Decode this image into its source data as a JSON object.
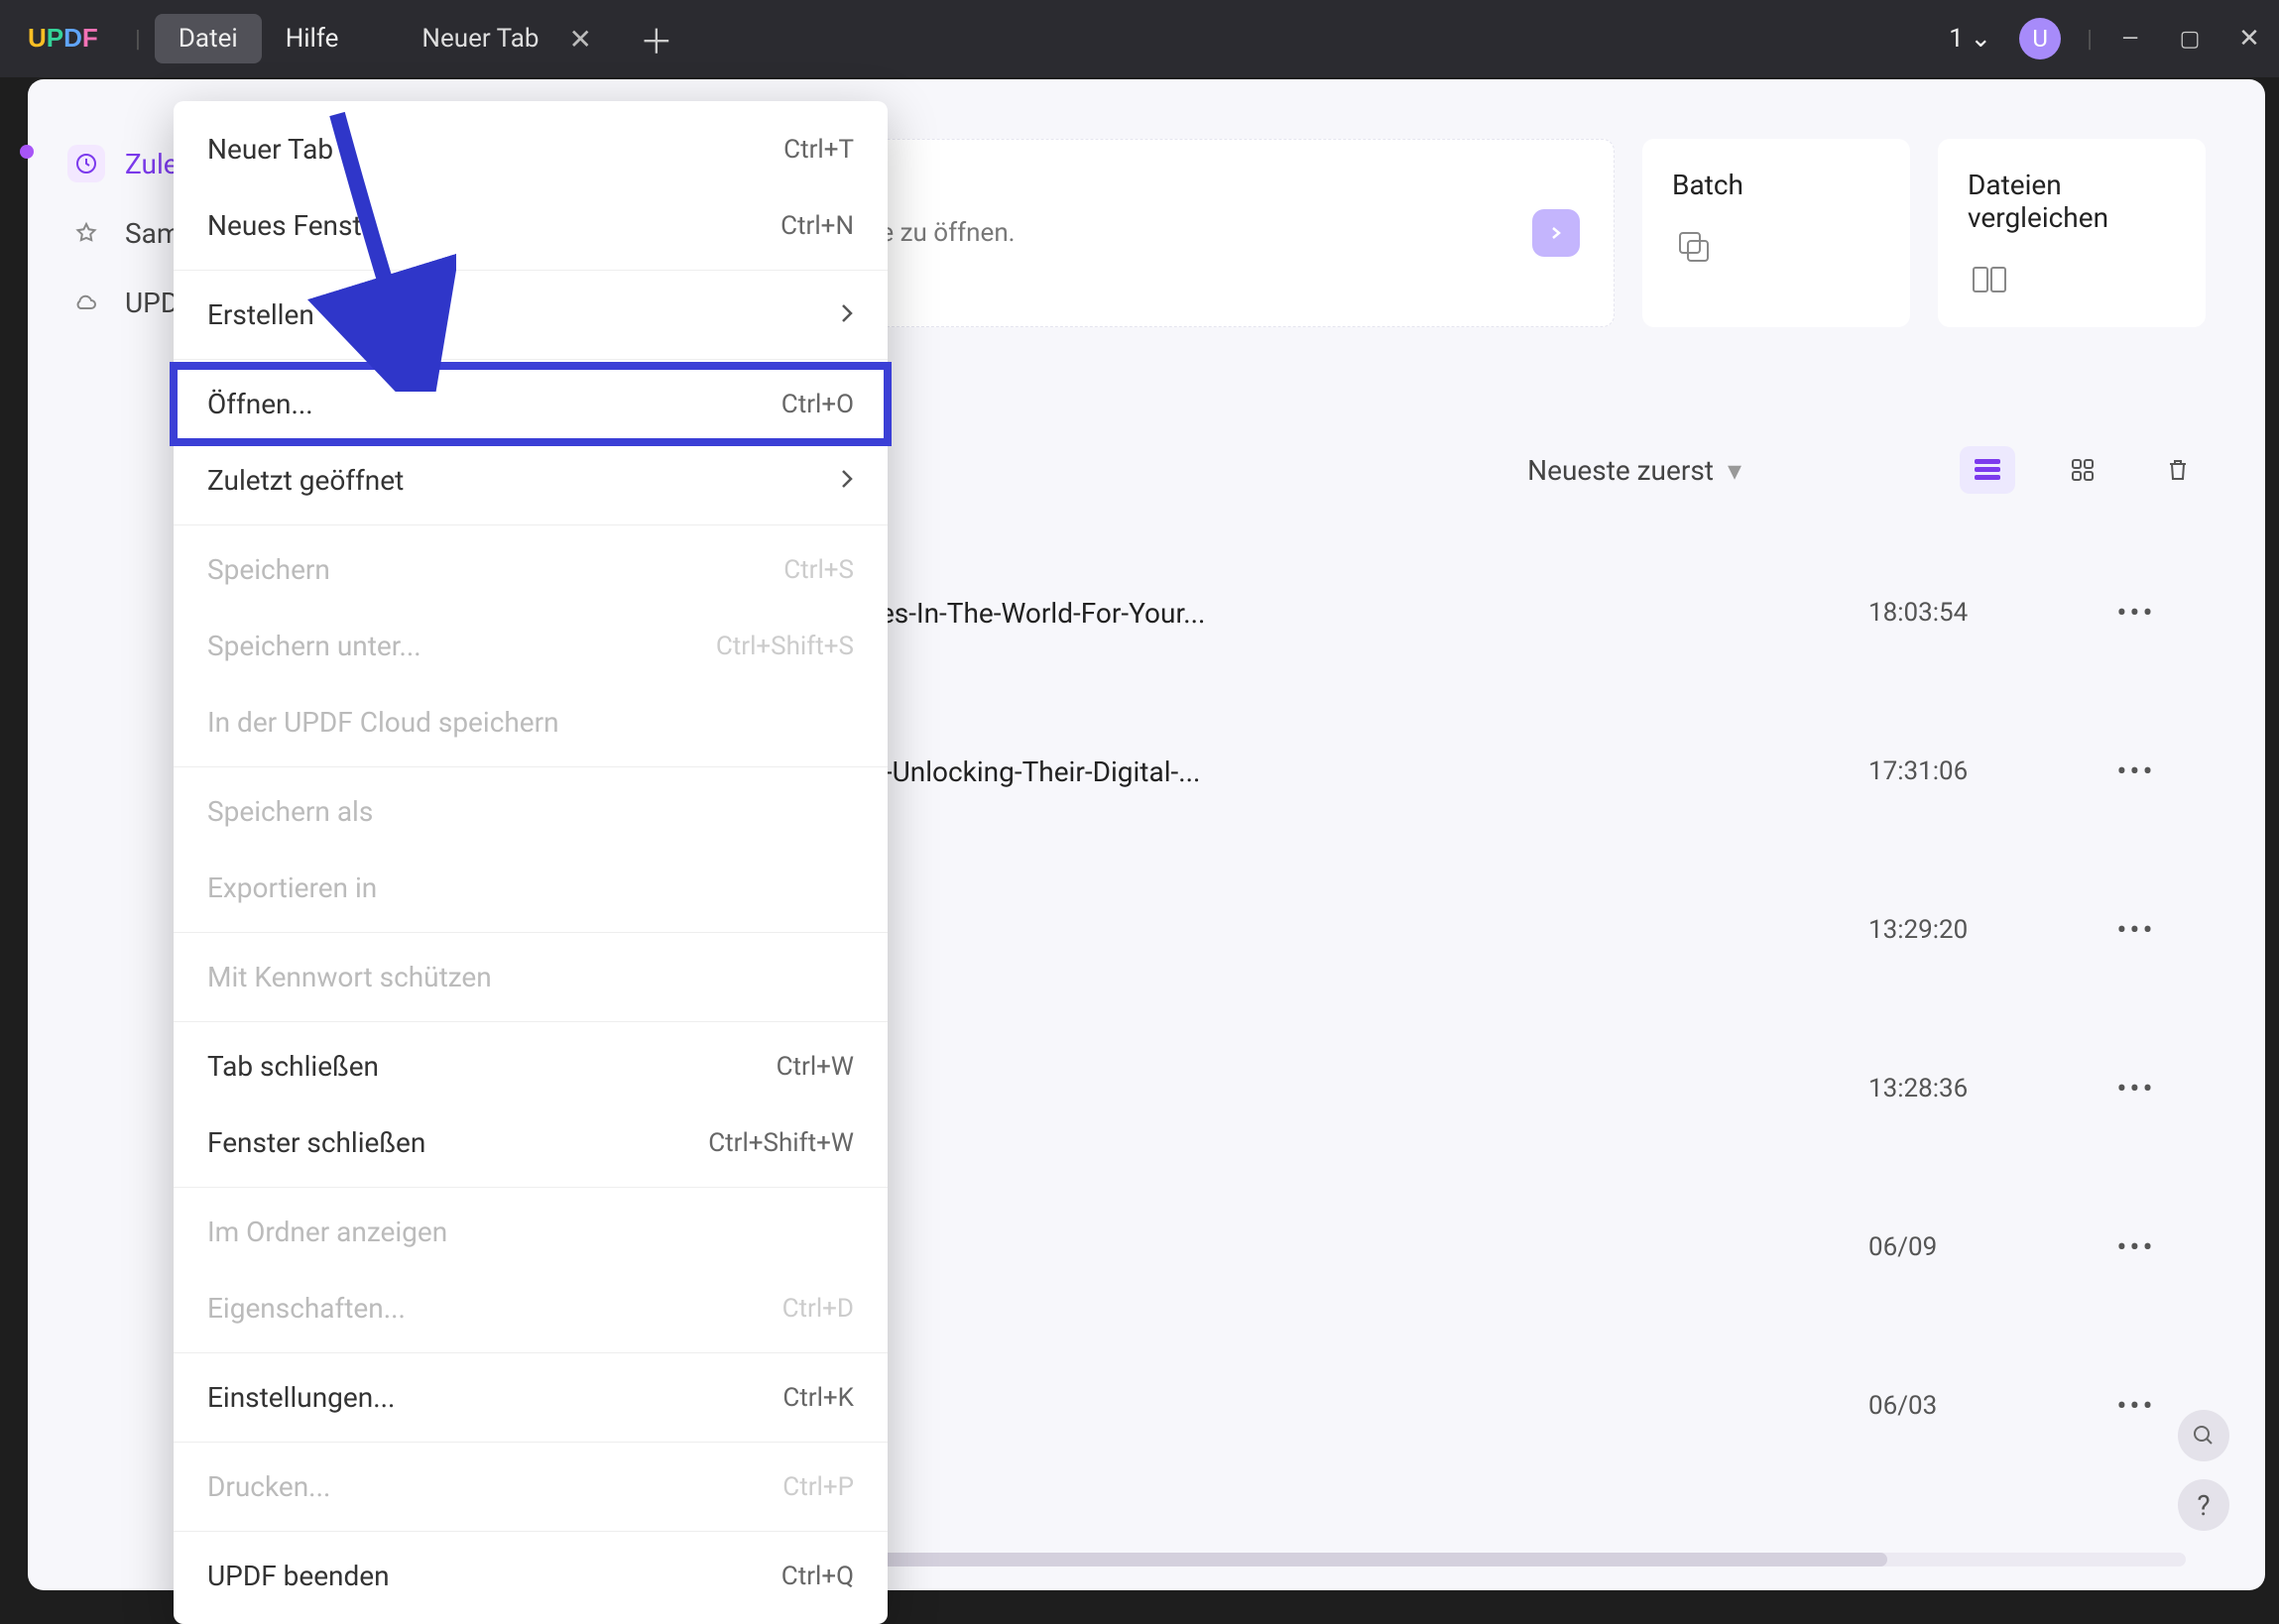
{
  "titlebar": {
    "menu_file": "Datei",
    "menu_help": "Hilfe",
    "tab_label": "Neuer Tab",
    "tab_count": "1",
    "avatar_initial": "U"
  },
  "sidebar": {
    "items": [
      {
        "label": "Zule"
      },
      {
        "label": "Sam"
      },
      {
        "label": "UPD"
      }
    ]
  },
  "hero": {
    "text": "hinein, um sie zu öffnen."
  },
  "cards": {
    "batch": "Batch",
    "compare": "Dateien vergleichen"
  },
  "sort": {
    "label": "Neueste zuerst"
  },
  "files": [
    {
      "name": "ne-Best-Institutes-In-The-World-For-Your...",
      "time": "18:03:54"
    },
    {
      "name": "e-Companies-in-Unlocking-Their-Digital-...",
      "time": "17:31:06"
    },
    {
      "name": "",
      "time": "13:29:20"
    },
    {
      "name": "",
      "time": "13:28:36"
    },
    {
      "name": "",
      "time": "06/09"
    },
    {
      "name": "",
      "time": "06/03"
    }
  ],
  "dropdown": [
    {
      "label": "Neuer Tab",
      "shortcut": "Ctrl+T",
      "enabled": true
    },
    {
      "label": "Neues Fenste",
      "shortcut": "Ctrl+N",
      "enabled": true
    },
    {
      "sep": true
    },
    {
      "label": "Erstellen",
      "submenu": true,
      "enabled": true
    },
    {
      "sep": true
    },
    {
      "label": "Öffnen...",
      "shortcut": "Ctrl+O",
      "enabled": true,
      "highlight": true
    },
    {
      "label": "Zuletzt geöffnet",
      "submenu": true,
      "enabled": true
    },
    {
      "sep": true
    },
    {
      "label": "Speichern",
      "shortcut": "Ctrl+S",
      "enabled": false
    },
    {
      "label": "Speichern unter...",
      "shortcut": "Ctrl+Shift+S",
      "enabled": false
    },
    {
      "label": "In der UPDF Cloud speichern",
      "enabled": false
    },
    {
      "sep": true
    },
    {
      "label": "Speichern als",
      "enabled": false
    },
    {
      "label": "Exportieren in",
      "enabled": false
    },
    {
      "sep": true
    },
    {
      "label": "Mit Kennwort schützen",
      "enabled": false
    },
    {
      "sep": true
    },
    {
      "label": "Tab schließen",
      "shortcut": "Ctrl+W",
      "enabled": true
    },
    {
      "label": "Fenster schließen",
      "shortcut": "Ctrl+Shift+W",
      "enabled": true
    },
    {
      "sep": true
    },
    {
      "label": "Im Ordner anzeigen",
      "enabled": false
    },
    {
      "label": "Eigenschaften...",
      "shortcut": "Ctrl+D",
      "enabled": false
    },
    {
      "sep": true
    },
    {
      "label": "Einstellungen...",
      "shortcut": "Ctrl+K",
      "enabled": true
    },
    {
      "sep": true
    },
    {
      "label": "Drucken...",
      "shortcut": "Ctrl+P",
      "enabled": false
    },
    {
      "sep": true
    },
    {
      "label": "UPDF beenden",
      "shortcut": "Ctrl+Q",
      "enabled": true
    }
  ]
}
